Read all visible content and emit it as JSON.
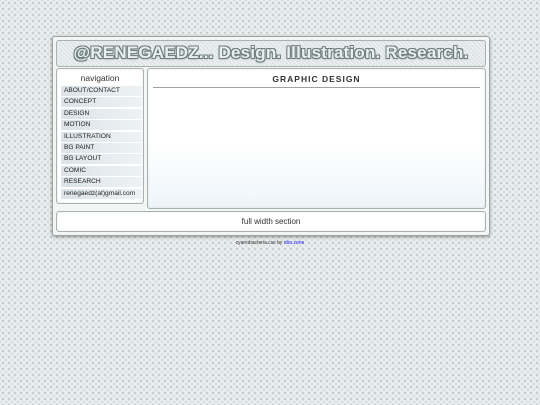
{
  "header": {
    "title": "@RENEGAEDZ... Design. Illustration. Research."
  },
  "nav": {
    "title": "navigation",
    "items": [
      "ABOUT/CONTACT",
      "CONCEPT",
      "DESIGN",
      "MOTION",
      "ILLUSTRATION",
      "BG PAINT",
      "BG LAYOUT",
      "COMIC",
      "RESEARCH",
      "renegaedz(at)gmail.com"
    ]
  },
  "main": {
    "title": "GRAPHIC DESIGN"
  },
  "footer": {
    "text": "full width section"
  },
  "credit": {
    "prefix": "cyanobacteria.css by",
    "link": "nbo.zone"
  },
  "colors": {
    "link": "#1a1aff",
    "nav_item_bg": "#dbe3e8",
    "frame_border": "#9aa4a4"
  }
}
